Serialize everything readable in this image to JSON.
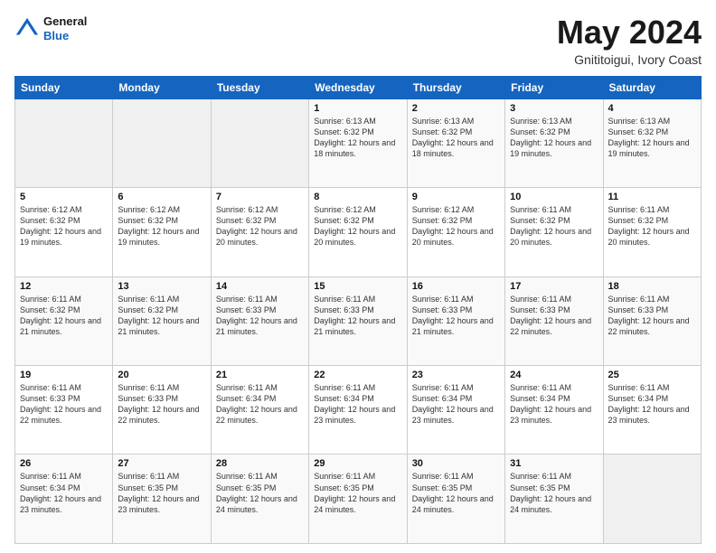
{
  "header": {
    "logo_general": "General",
    "logo_blue": "Blue",
    "month_title": "May 2024",
    "subtitle": "Gnititoigui, Ivory Coast"
  },
  "calendar": {
    "days_of_week": [
      "Sunday",
      "Monday",
      "Tuesday",
      "Wednesday",
      "Thursday",
      "Friday",
      "Saturday"
    ],
    "weeks": [
      [
        {
          "day": "",
          "content": ""
        },
        {
          "day": "",
          "content": ""
        },
        {
          "day": "",
          "content": ""
        },
        {
          "day": "1",
          "content": "Sunrise: 6:13 AM\nSunset: 6:32 PM\nDaylight: 12 hours\nand 18 minutes."
        },
        {
          "day": "2",
          "content": "Sunrise: 6:13 AM\nSunset: 6:32 PM\nDaylight: 12 hours\nand 18 minutes."
        },
        {
          "day": "3",
          "content": "Sunrise: 6:13 AM\nSunset: 6:32 PM\nDaylight: 12 hours\nand 19 minutes."
        },
        {
          "day": "4",
          "content": "Sunrise: 6:13 AM\nSunset: 6:32 PM\nDaylight: 12 hours\nand 19 minutes."
        }
      ],
      [
        {
          "day": "5",
          "content": "Sunrise: 6:12 AM\nSunset: 6:32 PM\nDaylight: 12 hours\nand 19 minutes."
        },
        {
          "day": "6",
          "content": "Sunrise: 6:12 AM\nSunset: 6:32 PM\nDaylight: 12 hours\nand 19 minutes."
        },
        {
          "day": "7",
          "content": "Sunrise: 6:12 AM\nSunset: 6:32 PM\nDaylight: 12 hours\nand 20 minutes."
        },
        {
          "day": "8",
          "content": "Sunrise: 6:12 AM\nSunset: 6:32 PM\nDaylight: 12 hours\nand 20 minutes."
        },
        {
          "day": "9",
          "content": "Sunrise: 6:12 AM\nSunset: 6:32 PM\nDaylight: 12 hours\nand 20 minutes."
        },
        {
          "day": "10",
          "content": "Sunrise: 6:11 AM\nSunset: 6:32 PM\nDaylight: 12 hours\nand 20 minutes."
        },
        {
          "day": "11",
          "content": "Sunrise: 6:11 AM\nSunset: 6:32 PM\nDaylight: 12 hours\nand 20 minutes."
        }
      ],
      [
        {
          "day": "12",
          "content": "Sunrise: 6:11 AM\nSunset: 6:32 PM\nDaylight: 12 hours\nand 21 minutes."
        },
        {
          "day": "13",
          "content": "Sunrise: 6:11 AM\nSunset: 6:32 PM\nDaylight: 12 hours\nand 21 minutes."
        },
        {
          "day": "14",
          "content": "Sunrise: 6:11 AM\nSunset: 6:33 PM\nDaylight: 12 hours\nand 21 minutes."
        },
        {
          "day": "15",
          "content": "Sunrise: 6:11 AM\nSunset: 6:33 PM\nDaylight: 12 hours\nand 21 minutes."
        },
        {
          "day": "16",
          "content": "Sunrise: 6:11 AM\nSunset: 6:33 PM\nDaylight: 12 hours\nand 21 minutes."
        },
        {
          "day": "17",
          "content": "Sunrise: 6:11 AM\nSunset: 6:33 PM\nDaylight: 12 hours\nand 22 minutes."
        },
        {
          "day": "18",
          "content": "Sunrise: 6:11 AM\nSunset: 6:33 PM\nDaylight: 12 hours\nand 22 minutes."
        }
      ],
      [
        {
          "day": "19",
          "content": "Sunrise: 6:11 AM\nSunset: 6:33 PM\nDaylight: 12 hours\nand 22 minutes."
        },
        {
          "day": "20",
          "content": "Sunrise: 6:11 AM\nSunset: 6:33 PM\nDaylight: 12 hours\nand 22 minutes."
        },
        {
          "day": "21",
          "content": "Sunrise: 6:11 AM\nSunset: 6:34 PM\nDaylight: 12 hours\nand 22 minutes."
        },
        {
          "day": "22",
          "content": "Sunrise: 6:11 AM\nSunset: 6:34 PM\nDaylight: 12 hours\nand 23 minutes."
        },
        {
          "day": "23",
          "content": "Sunrise: 6:11 AM\nSunset: 6:34 PM\nDaylight: 12 hours\nand 23 minutes."
        },
        {
          "day": "24",
          "content": "Sunrise: 6:11 AM\nSunset: 6:34 PM\nDaylight: 12 hours\nand 23 minutes."
        },
        {
          "day": "25",
          "content": "Sunrise: 6:11 AM\nSunset: 6:34 PM\nDaylight: 12 hours\nand 23 minutes."
        }
      ],
      [
        {
          "day": "26",
          "content": "Sunrise: 6:11 AM\nSunset: 6:34 PM\nDaylight: 12 hours\nand 23 minutes."
        },
        {
          "day": "27",
          "content": "Sunrise: 6:11 AM\nSunset: 6:35 PM\nDaylight: 12 hours\nand 23 minutes."
        },
        {
          "day": "28",
          "content": "Sunrise: 6:11 AM\nSunset: 6:35 PM\nDaylight: 12 hours\nand 24 minutes."
        },
        {
          "day": "29",
          "content": "Sunrise: 6:11 AM\nSunset: 6:35 PM\nDaylight: 12 hours\nand 24 minutes."
        },
        {
          "day": "30",
          "content": "Sunrise: 6:11 AM\nSunset: 6:35 PM\nDaylight: 12 hours\nand 24 minutes."
        },
        {
          "day": "31",
          "content": "Sunrise: 6:11 AM\nSunset: 6:35 PM\nDaylight: 12 hours\nand 24 minutes."
        },
        {
          "day": "",
          "content": ""
        }
      ]
    ]
  }
}
